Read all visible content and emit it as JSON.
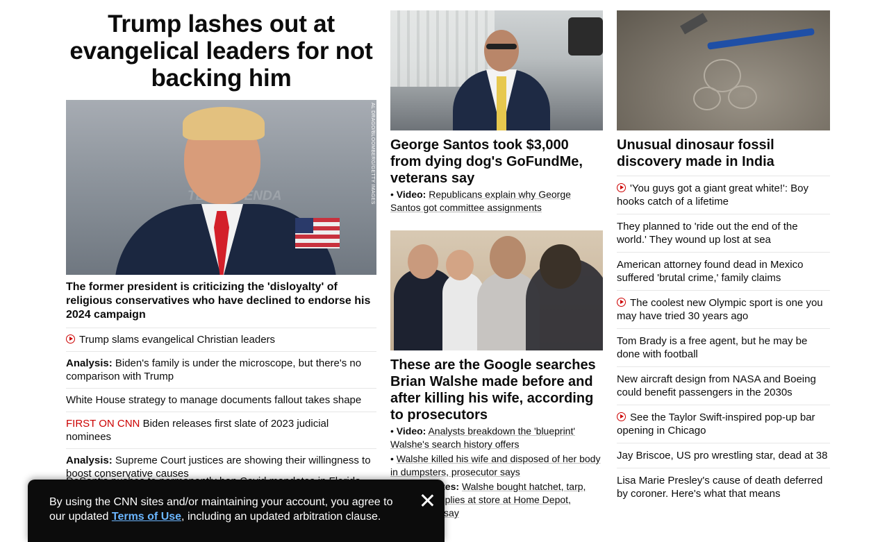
{
  "col1": {
    "headline": "Trump lashes out at evangelical leaders for not backing him",
    "hero_bg_text": "TEXT AGENDA",
    "hero_credit": "AL DRAGO/BLOOMBERG/GETTY IMAGES",
    "lede": "The former president is criticizing the 'disloyalty' of religious conservatives who have declined to endorse his 2024 campaign",
    "items": [
      {
        "icon": "play-icon",
        "text": "Trump slams evangelical Christian leaders"
      },
      {
        "label": "Analysis:",
        "text": "Biden's family is under the microscope, but there's no comparison with Trump"
      },
      {
        "text": "White House strategy to manage documents fallout takes shape"
      },
      {
        "label_red": "FIRST ON CNN",
        "text": "Biden releases first slate of 2023 judicial nominees"
      },
      {
        "label": "Analysis:",
        "text": "Supreme Court justices are showing their willingness to boost conservative causes"
      }
    ],
    "partial_item": "DeSantis pushes to permanently ban Covid mandates in Florida"
  },
  "col2": {
    "story1": {
      "headline": "George Santos took $3,000 from dying dog's GoFundMe, veterans say",
      "bullets": [
        {
          "label": "Video:",
          "text": "Republicans explain why George Santos got committee assignments"
        }
      ]
    },
    "story2": {
      "headline": "These are the Google searches Brian Walshe made before and after killing his wife, according to prosecutors",
      "bullets": [
        {
          "label": "Video:",
          "text": "Analysts breakdown the 'blueprint' Walshe's search history offers"
        },
        {
          "label": "",
          "text": "Walshe killed his wife and disposed of her body in dumpsters, prosecutor says"
        },
        {
          "label": "Live updates:",
          "text": "Walshe bought hatchet, tarp, cleaning supplies at store at Home Depot, prosecutors say"
        }
      ]
    }
  },
  "col3": {
    "headline": "Unusual dinosaur fossil discovery made in India",
    "items": [
      {
        "icon": "play-icon",
        "text": "'You guys got a giant great white!': Boy hooks catch of a lifetime"
      },
      {
        "text": "They planned to 'ride out the end of the world.' They wound up lost at sea"
      },
      {
        "text": "American attorney found dead in Mexico suffered 'brutal crime,' family claims"
      },
      {
        "icon": "play-icon",
        "text": "The coolest new Olympic sport is one you may have tried 30 years ago"
      },
      {
        "text": "Tom Brady is a free agent, but he may be done with football"
      },
      {
        "text": "New aircraft design from NASA and Boeing could benefit passengers in the 2030s"
      },
      {
        "icon": "play-icon",
        "text": "See the Taylor Swift-inspired pop-up bar opening in Chicago"
      },
      {
        "text": "Jay Briscoe, US pro wrestling star, dead at 38"
      },
      {
        "text": "Lisa Marie Presley's cause of death deferred by coroner. Here's what that means"
      }
    ]
  },
  "consent": {
    "text_before": "By using the CNN sites and/or maintaining your account, you agree to our updated ",
    "link_text": "Terms of Use",
    "text_after": ", including an updated arbitration clause."
  },
  "colors": {
    "text": "#0c0c0c",
    "accent_red": "#cc0000",
    "banner_bg": "#0c0c0c",
    "banner_link": "#6bb6ff",
    "divider": "#e6e6e6"
  }
}
